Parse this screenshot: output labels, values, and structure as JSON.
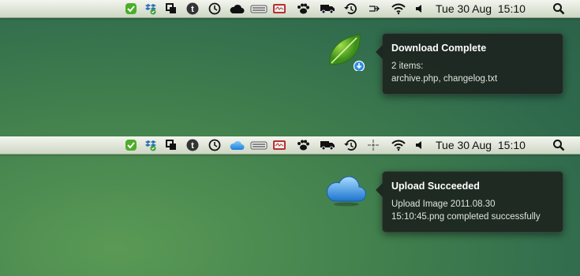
{
  "screens": [
    {
      "menubar": {
        "cloud_icon": "cloud-black-icon",
        "clock_text": "Tue 30 Aug  15:10"
      },
      "notification": {
        "app_icon": "leaf-download-icon",
        "title": "Download Complete",
        "line1": "2 items:",
        "line2": "archive.php, changelog.txt"
      }
    },
    {
      "menubar": {
        "cloud_icon": "cloud-blue-icon",
        "clock_text": "Tue 30 Aug  15:10"
      },
      "notification": {
        "app_icon": "cloud-app-icon",
        "title": "Upload Succeeded",
        "line1": "Upload Image 2011.08.30",
        "line2": "15:10:45.png completed successfully"
      }
    }
  ],
  "colors": {
    "desktop_green": "#3f7d4d",
    "notification_bg": "#1c221e",
    "menubar_top": "#f3f5ee",
    "accent_blue": "#2d8fe3"
  }
}
